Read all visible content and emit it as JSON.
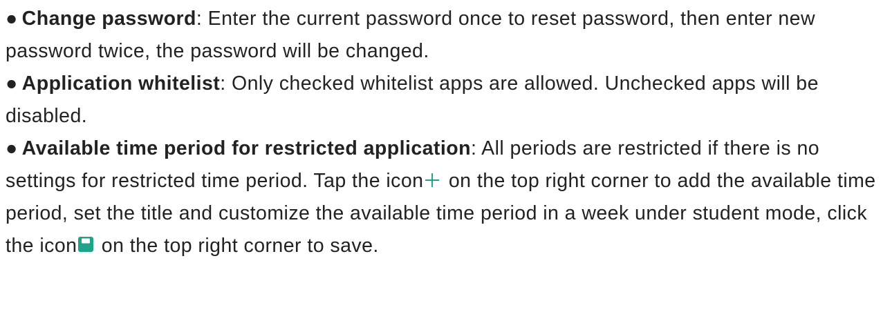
{
  "paragraphs": [
    {
      "bullet": "●",
      "term": "Change password",
      "text": ": Enter the current password once to reset password, then enter new password twice, the password will be changed."
    },
    {
      "bullet": "●",
      "term": "Application whitelist",
      "text": ": Only checked whitelist apps are allowed. Unchecked apps will be disabled."
    },
    {
      "bullet": "●",
      "term": "Available time period for restricted application",
      "text_before_add_icon": ": All periods are restricted if there is no settings for restricted time period. Tap the icon",
      "text_before_save_icon": " on the top right corner to add the available time period, set the title and customize the available time period in a week under student mode, click the icon",
      "text_after_save_icon": " on the top right corner to save."
    }
  ],
  "icons": {
    "add": {
      "name": "plus-icon",
      "color": "#1fa38b"
    },
    "save": {
      "name": "save-icon",
      "color": "#1fa38b"
    }
  }
}
